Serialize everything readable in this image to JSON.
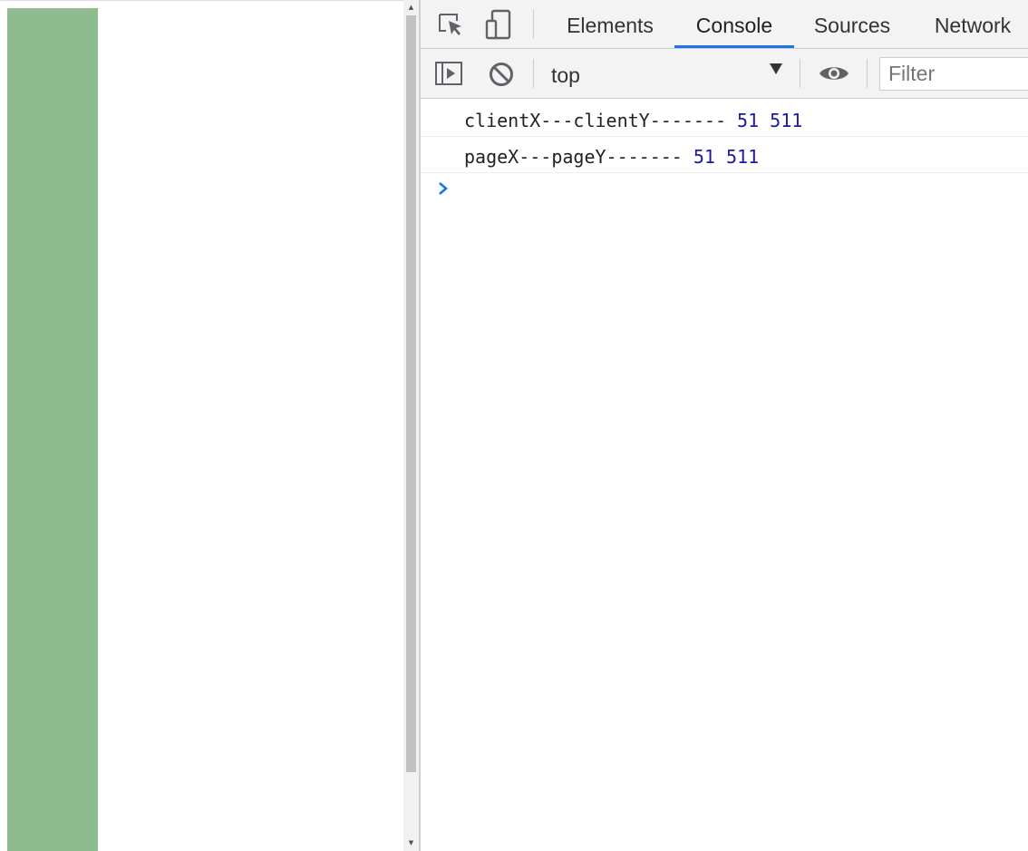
{
  "page": {
    "green_box_color": "#8fbc8f"
  },
  "devtools": {
    "tabs": [
      {
        "label": "Elements"
      },
      {
        "label": "Console",
        "selected": true
      },
      {
        "label": "Sources"
      },
      {
        "label": "Network"
      }
    ],
    "toolbar": {
      "context": "top",
      "filter_placeholder": "Filter"
    },
    "console": {
      "logs": [
        {
          "text": "clientX---clientY-------",
          "num1": "51",
          "num2": "511"
        },
        {
          "text": "pageX---pageY-------",
          "num1": "51",
          "num2": "511"
        }
      ]
    },
    "accent_color": "#1a73e8"
  }
}
